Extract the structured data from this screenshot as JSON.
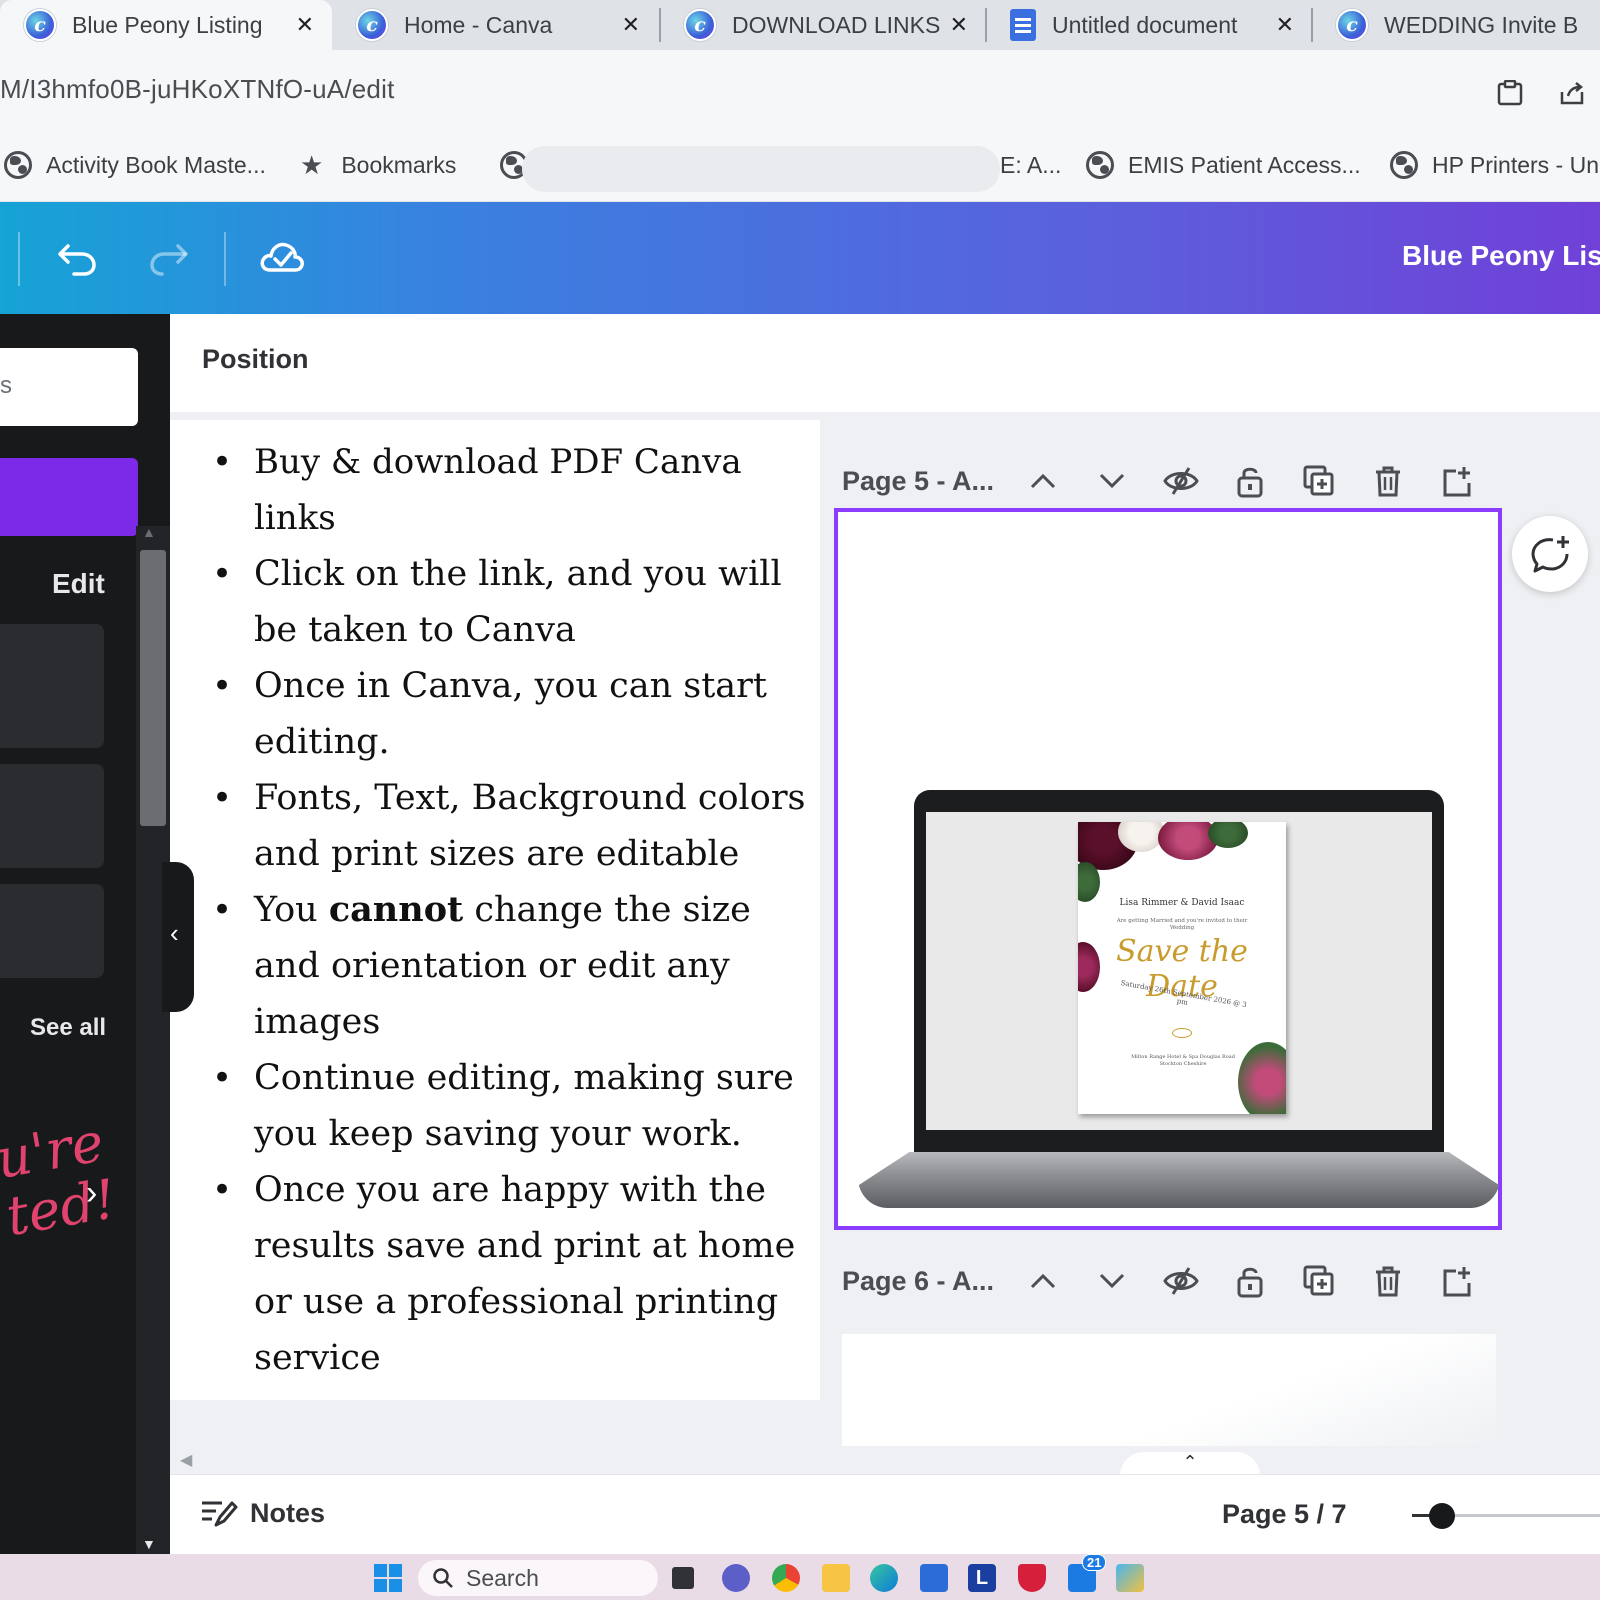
{
  "browser": {
    "tabs": [
      {
        "title": "Blue Peony Listing",
        "icon": "canva-icon",
        "active": true
      },
      {
        "title": "Home - Canva",
        "icon": "canva-icon",
        "active": false
      },
      {
        "title": "DOWNLOAD LINKS",
        "icon": "canva-icon",
        "active": false
      },
      {
        "title": "Untitled document",
        "icon": "docs-icon",
        "active": false
      },
      {
        "title": "WEDDING Invite B",
        "icon": "canva-icon",
        "active": false
      }
    ],
    "url": "M/I3hmfo0B-juHKoXTNfO-uA/edit",
    "bookmarks": [
      {
        "label": "Activity Book Maste...",
        "icon": "globe-icon"
      },
      {
        "label": "Bookmarks",
        "icon": "star-icon"
      },
      {
        "label": "E: A...",
        "icon": "globe-icon"
      },
      {
        "label": "EMIS Patient Access...",
        "icon": "globe-icon"
      },
      {
        "label": "HP Printers - Un",
        "icon": "globe-icon"
      }
    ]
  },
  "editor": {
    "design_title": "Blue Peony Listi",
    "toolbar_label": "Position",
    "left_panel": {
      "search_text": "s",
      "edit_label": "Edit",
      "see_all": "See all",
      "script_text": "u're ted!"
    },
    "instructions": {
      "items": [
        {
          "pre": "Buy & download PDF Canva links",
          "bold": "",
          "post": ""
        },
        {
          "pre": "Click on the link, and you will be taken to Canva",
          "bold": "",
          "post": ""
        },
        {
          "pre": "Once in Canva, you can start editing.",
          "bold": "",
          "post": ""
        },
        {
          "pre": " Fonts, Text, Background colors and print sizes are editable",
          "bold": "",
          "post": ""
        },
        {
          "pre": "You ",
          "bold": "cannot",
          "post": " change the size and orientation or edit any images"
        },
        {
          "pre": "Continue editing, making sure you keep saving your work.",
          "bold": "",
          "post": ""
        },
        {
          "pre": "Once you are happy with the results save and print at home or use a professional printing service",
          "bold": "",
          "post": ""
        }
      ]
    },
    "pages": [
      {
        "label": "Page 5 - A..."
      },
      {
        "label": "Page 6 - A..."
      }
    ],
    "invite": {
      "couple": "Lisa Rimmer & David Isaac",
      "subtitle": "Are getting Married and you're invited to their Wedding",
      "headline": "Save the Date",
      "date": "Saturday 26th September 2026 @ 3 pm",
      "venue": "Milton Range Hotel & Spa Douglas Road Stockton Cheshire"
    },
    "footer": {
      "notes": "Notes",
      "page_count": "Page 5 / 7",
      "zoom_level": 0.15
    }
  },
  "taskbar": {
    "search_placeholder": "Search",
    "apps": [
      "file-explorer-icon",
      "chat-icon",
      "chrome-icon",
      "folder-icon",
      "edge-icon",
      "store-icon",
      "l-app-icon",
      "mcafee-icon",
      "mail-icon",
      "photos-icon"
    ],
    "mail_badge": "21"
  },
  "colors": {
    "canva_purple": "#8b3dff",
    "header_gradient_start": "#16a3d6",
    "header_gradient_end": "#7040d8",
    "panel_dark": "#18191b"
  }
}
